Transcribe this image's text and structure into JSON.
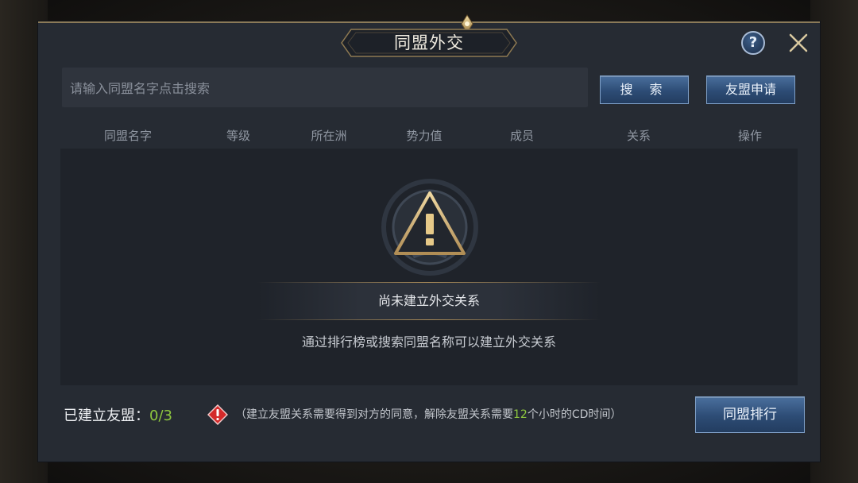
{
  "window": {
    "title": "同盟外交"
  },
  "header": {
    "help_label": "?"
  },
  "search": {
    "placeholder": "请输入同盟名字点击搜索",
    "value": "",
    "search_button": "搜 索",
    "ally_request_button": "友盟申请"
  },
  "table": {
    "columns": [
      "同盟名字",
      "等级",
      "所在洲",
      "势力值",
      "成员",
      "关系",
      "操作"
    ],
    "rows": []
  },
  "empty_state": {
    "title": "尚未建立外交关系",
    "hint": "通过排行榜或搜索同盟名称可以建立外交关系"
  },
  "footer": {
    "established_label": "已建立友盟：",
    "established_count": "0/3",
    "notice_before": "（建立友盟关系需要得到对方的同意，解除友盟关系需要",
    "notice_hours": "12",
    "notice_after": "个小时的CD时间）",
    "ranking_button": "同盟排行"
  },
  "colors": {
    "panel_bg": "#262b33",
    "accent_gold": "#a88a58",
    "highlight_green": "#8fc83f",
    "button_blue": "#2d4c75",
    "warning_red": "#d42a2a"
  },
  "icons": [
    "help-icon",
    "close-icon",
    "warning-triangle-icon",
    "warning-diamond-icon"
  ]
}
